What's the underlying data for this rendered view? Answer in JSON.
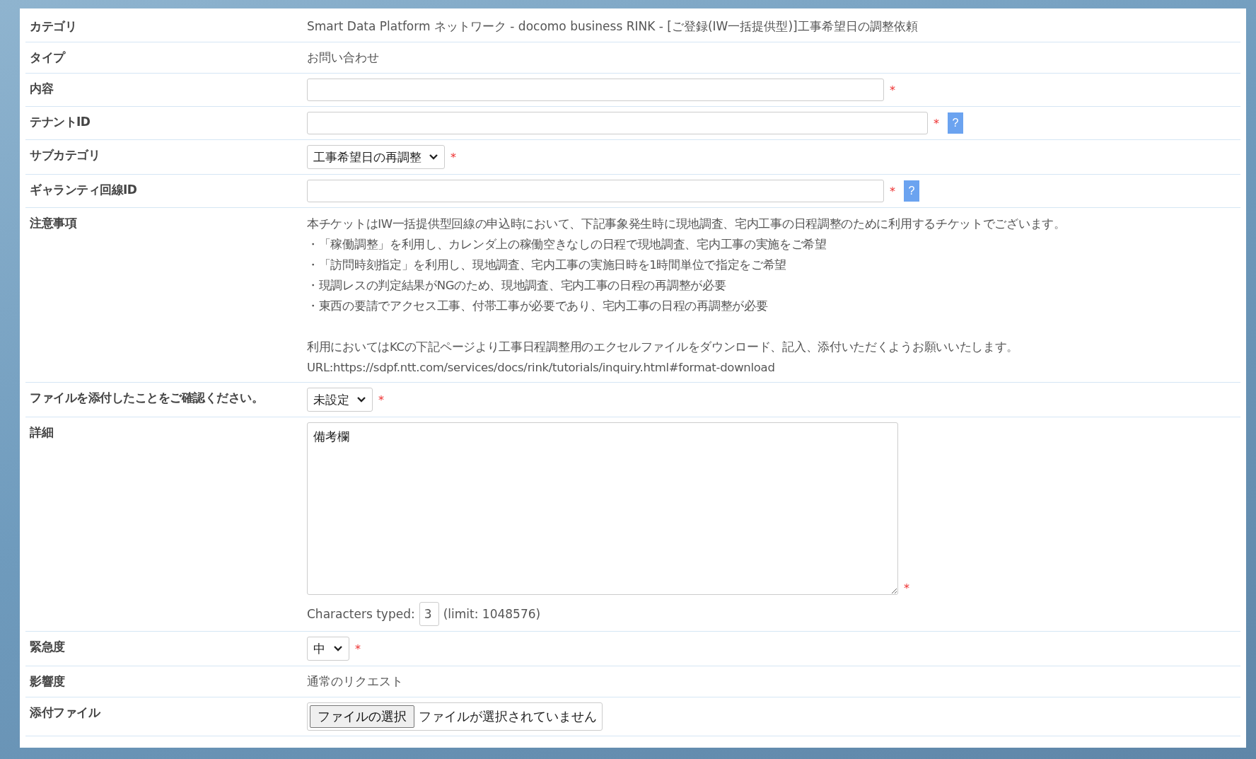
{
  "rows": [
    {
      "kind": "text",
      "label": "カテゴリ",
      "value": "Smart Data Platform ネットワーク - docomo business RINK - [ご登録(IW一括提供型)]工事希望日の調整依頼"
    },
    {
      "kind": "text",
      "label": "タイプ",
      "value": "お問い合わせ"
    },
    {
      "kind": "input",
      "label": "内容",
      "required": "*"
    },
    {
      "kind": "input",
      "label": "テナントID",
      "required": "*",
      "help": "?"
    },
    {
      "kind": "select",
      "label": "サブカテゴリ",
      "value": "工事希望日の再調整",
      "required": "*"
    },
    {
      "kind": "input",
      "label": "ギャランティ回線ID",
      "required": "*",
      "help": "?"
    },
    {
      "kind": "notes",
      "label": "注意事項",
      "paragraphs": [
        [
          "本チケットはIW一括提供型回線の申込時において、下記事象発生時に現地調査、宅内工事の日程調整のために利用するチケットでございます。",
          "・「稼働調整」を利用し、カレンダ上の稼働空きなしの日程で現地調査、宅内工事の実施をご希望",
          "・「訪問時刻指定」を利用し、現地調査、宅内工事の実施日時を1時間単位で指定をご希望",
          "・現調レスの判定結果がNGのため、現地調査、宅内工事の日程の再調整が必要",
          "・東西の要請でアクセス工事、付帯工事が必要であり、宅内工事の日程の再調整が必要"
        ],
        [
          "利用においてはKCの下記ページより工事日程調整用のエクセルファイルをダウンロード、記入、添付いただくようお願いいたします。",
          "URL:https://sdpf.ntt.com/services/docs/rink/tutorials/inquiry.html#format-download"
        ]
      ]
    },
    {
      "kind": "select",
      "label": "ファイルを添付したことをご確認ください。",
      "value": "未設定",
      "required": "*"
    },
    {
      "kind": "textarea",
      "label": "詳細",
      "value": "備考欄",
      "required": "*",
      "counter_label": "Characters typed:",
      "counter_value": "3",
      "counter_limit": "(limit: 1048576)"
    },
    {
      "kind": "select",
      "label": "緊急度",
      "value": "中",
      "required": "*"
    },
    {
      "kind": "text",
      "label": "影響度",
      "value": "通常のリクエスト"
    },
    {
      "kind": "file",
      "label": "添付ファイル",
      "button": "ファイルの選択",
      "status": "ファイルが選択されていません"
    }
  ]
}
